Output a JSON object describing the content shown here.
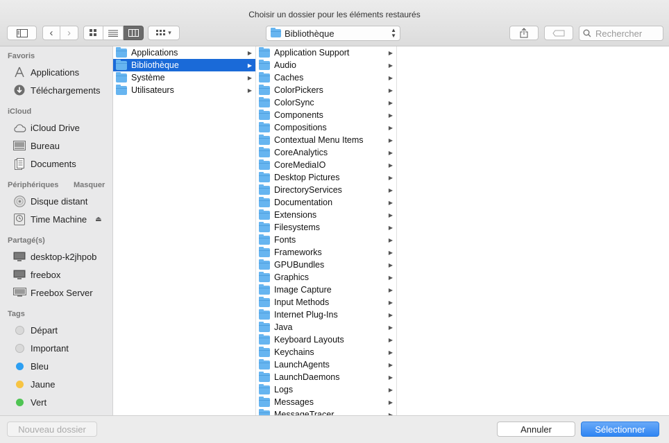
{
  "window": {
    "title": "Choisir un dossier pour les éléments restaurés"
  },
  "toolbar": {
    "path_popup": "Bibliothèque",
    "search_placeholder": "Rechercher"
  },
  "sidebar": {
    "favoris_header": "Favoris",
    "favoris": [
      {
        "label": "Applications",
        "icon": "applications-icon"
      },
      {
        "label": "Téléchargements",
        "icon": "downloads-icon"
      }
    ],
    "icloud_header": "iCloud",
    "icloud": [
      {
        "label": "iCloud Drive",
        "icon": "cloud-icon"
      },
      {
        "label": "Bureau",
        "icon": "desktop-icon"
      },
      {
        "label": "Documents",
        "icon": "documents-icon"
      }
    ],
    "peripheriques_header": "Périphériques",
    "masquer": "Masquer",
    "peripheriques": [
      {
        "label": "Disque distant",
        "icon": "disc-icon"
      },
      {
        "label": "Time Machine",
        "icon": "time-machine-icon"
      }
    ],
    "partage_header": "Partagé(s)",
    "partage": [
      {
        "label": "desktop-k2jhpob",
        "icon": "computer-icon"
      },
      {
        "label": "freebox",
        "icon": "computer-icon"
      },
      {
        "label": "Freebox Server",
        "icon": "display-icon"
      }
    ],
    "tags_header": "Tags",
    "tags": [
      {
        "label": "Départ",
        "color": "#d9d9d9"
      },
      {
        "label": "Important",
        "color": "#d9d9d9"
      },
      {
        "label": "Bleu",
        "color": "#2d9ff2"
      },
      {
        "label": "Jaune",
        "color": "#f7c443"
      },
      {
        "label": "Vert",
        "color": "#4fc453"
      }
    ]
  },
  "column1": [
    {
      "label": "Applications",
      "icon": "applications-folder-icon",
      "selected": false
    },
    {
      "label": "Bibliothèque",
      "icon": "library-folder-icon",
      "selected": true
    },
    {
      "label": "Système",
      "icon": "system-folder-icon",
      "selected": false
    },
    {
      "label": "Utilisateurs",
      "icon": "users-folder-icon",
      "selected": false
    }
  ],
  "column2": [
    "Application Support",
    "Audio",
    "Caches",
    "ColorPickers",
    "ColorSync",
    "Components",
    "Compositions",
    "Contextual Menu Items",
    "CoreAnalytics",
    "CoreMediaIO",
    "Desktop Pictures",
    "DirectoryServices",
    "Documentation",
    "Extensions",
    "Filesystems",
    "Fonts",
    "Frameworks",
    "GPUBundles",
    "Graphics",
    "Image Capture",
    "Input Methods",
    "Internet Plug-Ins",
    "Java",
    "Keyboard Layouts",
    "Keychains",
    "LaunchAgents",
    "LaunchDaemons",
    "Logs",
    "Messages",
    "MessageTracer"
  ],
  "bottom": {
    "new_folder": "Nouveau dossier",
    "cancel": "Annuler",
    "select": "Sélectionner"
  },
  "colors": {
    "accent": "#1a6ad8",
    "select_button": "#3c8ff5",
    "folder": "#67b5f0"
  }
}
